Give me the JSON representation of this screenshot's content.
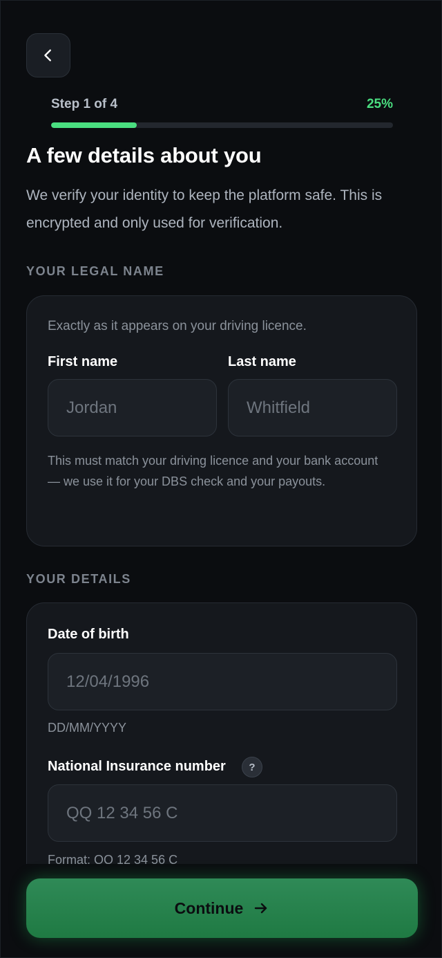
{
  "header": {
    "back_icon": "chevron-left-icon",
    "step_label": "Step 1 of 4",
    "progress_text": "25%",
    "progress_fraction": 0.25,
    "accent_color": "#4ade80"
  },
  "intro": {
    "title": "A few details about you",
    "subtitle": "We verify your identity to keep the platform safe. This is encrypted and only used for verification."
  },
  "legal_name": {
    "section_label": "YOUR LEGAL NAME",
    "hint": "Exactly as it appears on your driving licence.",
    "first_name_label": "First name",
    "first_name_placeholder": "Jordan",
    "last_name_label": "Last name",
    "last_name_placeholder": "Whitfield",
    "help": "This must match your driving licence and your bank account — we use it for your DBS check and your payouts."
  },
  "details": {
    "section_label": "YOUR DETAILS",
    "dob_label": "Date of birth",
    "dob_placeholder": "12/04/1996",
    "dob_format": "DD/MM/YYYY",
    "ni_label": "National Insurance number",
    "ni_info_icon": "question-icon",
    "ni_info_glyph": "?",
    "ni_placeholder": "QQ 12 34 56 C",
    "ni_format": "Format: QQ 12 34 56 C"
  },
  "footer": {
    "continue_label": "Continue",
    "continue_icon": "arrow-right-icon"
  }
}
